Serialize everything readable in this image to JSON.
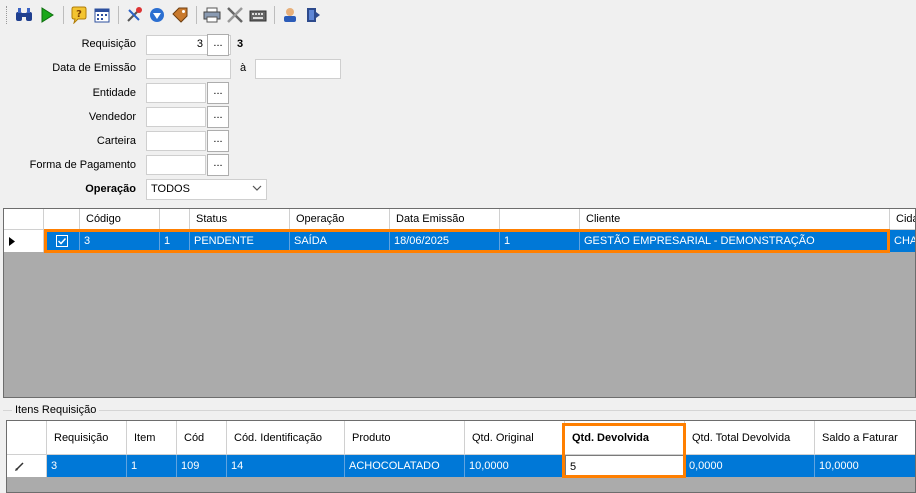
{
  "toolbar": {
    "icons": [
      "binoculars-icon",
      "play-icon",
      "help-icon",
      "calendar-icon",
      "tools-icon",
      "download-icon",
      "tag-icon",
      "printer-icon",
      "settings-icon",
      "keyboard-icon",
      "user-icon",
      "exit-icon"
    ]
  },
  "filters": {
    "requisicao_label": "Requisição",
    "requisicao_value": "3",
    "requisicao_display": "3",
    "data_emissao_label": "Data de Emissão",
    "data_sep": "à",
    "entidade_label": "Entidade",
    "vendedor_label": "Vendedor",
    "carteira_label": "Carteira",
    "forma_pagamento_label": "Forma de Pagamento",
    "operacao_label": "Operação",
    "operacao_value": "TODOS",
    "dots": "..."
  },
  "grid_requisicoes": {
    "headers": [
      "",
      "Código",
      "",
      "Status",
      "Operação",
      "Data Emissão",
      "",
      "Cliente",
      "Cida"
    ],
    "row": {
      "codigo": "3",
      "col3": "1",
      "status": "PENDENTE",
      "operacao": "SAÍDA",
      "data_emissao": "18/06/2025",
      "col7": "1",
      "cliente": "GESTÃO EMPRESARIAL - DEMONSTRAÇÃO",
      "cidade": "CHAP"
    }
  },
  "itens": {
    "group_title": "Itens Requisição",
    "headers": [
      "Requisição",
      "Item",
      "Cód",
      "Cód. Identificação",
      "Produto",
      "Qtd. Original",
      "Qtd. Devolvida",
      "Qtd. Total Devolvida",
      "Saldo a Faturar"
    ],
    "row": {
      "requisicao": "3",
      "item": "1",
      "cod": "109",
      "cod_identificacao": "14",
      "produto": "ACHOCOLATADO",
      "qtd_original": "10,0000",
      "qtd_devolvida": "5",
      "qtd_total_devolvida": "0,0000",
      "saldo_faturar": "10,0000"
    }
  },
  "colors": {
    "selection": "#0078d7",
    "highlight": "#ff7f00",
    "grid_bg": "#ababab"
  }
}
